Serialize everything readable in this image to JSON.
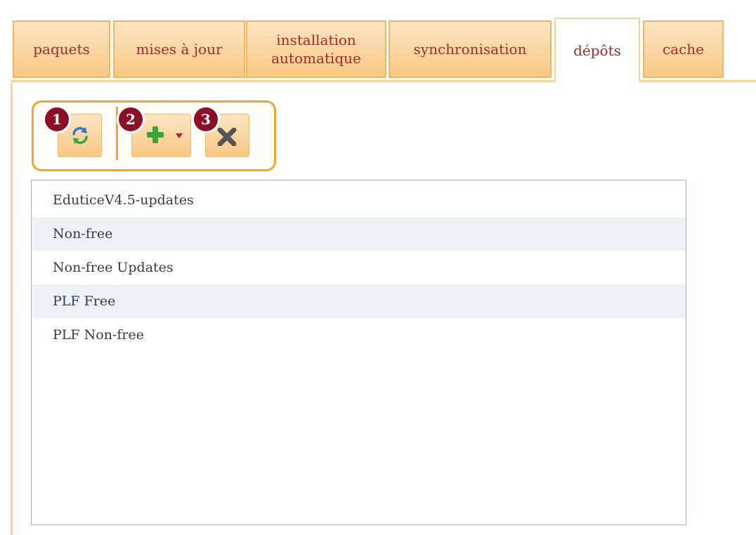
{
  "tabs": [
    {
      "label": "paquets",
      "active": false
    },
    {
      "label": "mises à jour",
      "active": false
    },
    {
      "label": "installation automatique",
      "active": false
    },
    {
      "label": "synchronisation",
      "active": false
    },
    {
      "label": "dépôts",
      "active": true
    },
    {
      "label": "cache",
      "active": false
    }
  ],
  "toolbar": {
    "badges": [
      "1",
      "2",
      "3"
    ],
    "buttons": [
      {
        "icon": "refresh-icon"
      },
      {
        "icon": "add-plus-icon",
        "dropdown": "dropdown-arrow-icon"
      },
      {
        "icon": "delete-x-icon"
      }
    ]
  },
  "repositories": [
    "EduticeV4.5-updates",
    "Non-free",
    "Non-free Updates",
    "PLF Free",
    "PLF Non-free"
  ],
  "colors": {
    "tab_text": "#a52a2a",
    "tab_border": "#f5b560",
    "toolbar_border": "#f5a623",
    "badge": "#8b0f26",
    "row_alt": "#edf1f8"
  }
}
